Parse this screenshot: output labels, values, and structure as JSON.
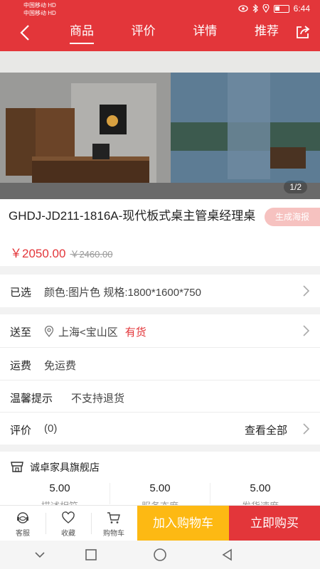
{
  "status_bar": {
    "carrier_1": "中国移动 HD",
    "carrier_2": "中国移动 HD",
    "time": "6:44"
  },
  "nav": {
    "tabs": [
      {
        "label": "商品",
        "active": true
      },
      {
        "label": "评价",
        "active": false
      },
      {
        "label": "详情",
        "active": false
      },
      {
        "label": "推荐",
        "active": false
      }
    ]
  },
  "hero": {
    "pager": "1/2"
  },
  "product": {
    "title": "GHDJ-JD211-1816A-现代板式桌主管桌经理桌",
    "poster_button": "生成海报",
    "price": "￥2050.00",
    "original_price": "￥2460.00"
  },
  "selected": {
    "label": "已选",
    "value": "颜色:图片色 规格:1800*1600*750"
  },
  "delivery": {
    "label": "送至",
    "location": "上海<宝山区",
    "stock": "有货"
  },
  "shipping": {
    "label": "运费",
    "value": "免运费"
  },
  "notice": {
    "label": "温馨提示",
    "value": "不支持退货"
  },
  "reviews": {
    "label": "评价",
    "count": "(0)",
    "view_all": "查看全部"
  },
  "store": {
    "name": "诚卓家具旗舰店",
    "scores": [
      {
        "value": "5.00",
        "label": "描述相符"
      },
      {
        "value": "5.00",
        "label": "服务态度"
      },
      {
        "value": "5.00",
        "label": "发货速度"
      }
    ]
  },
  "actions": {
    "service": "客服",
    "favorite": "收藏",
    "cart": "购物车",
    "add_to_cart": "加入购物车",
    "buy_now": "立即购买"
  },
  "colors": {
    "brand_red": "#e3363a",
    "cart_yellow": "#fdb913"
  }
}
